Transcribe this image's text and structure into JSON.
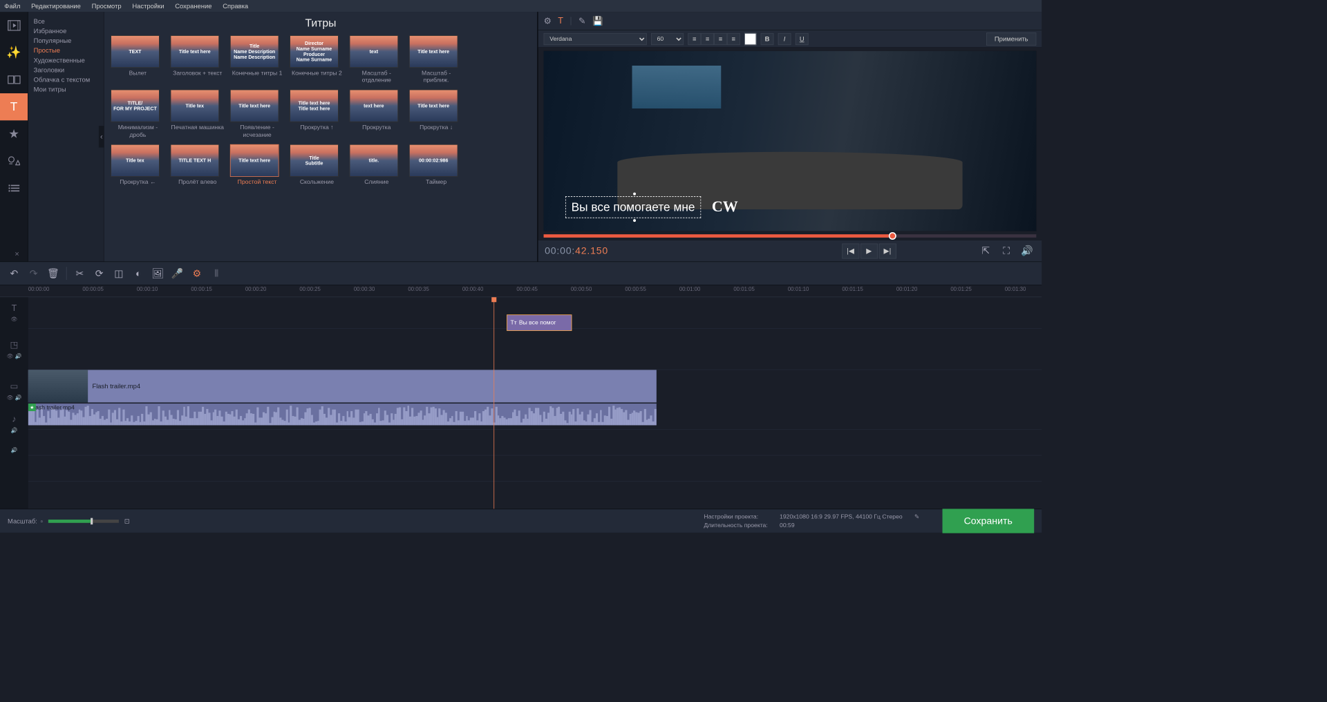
{
  "menu": [
    "Файл",
    "Редактирование",
    "Просмотр",
    "Настройки",
    "Сохранение",
    "Справка"
  ],
  "categories": {
    "items": [
      "Все",
      "Избранное",
      "Популярные",
      "Простые",
      "Художественные",
      "Заголовки",
      "Облачка с текстом",
      "Мои титры"
    ],
    "active": "Простые"
  },
  "gallery": {
    "title": "Титры",
    "items": [
      {
        "label": "Вылет",
        "preview": "TEXT"
      },
      {
        "label": "Заголовок + текст",
        "preview": "Title text here"
      },
      {
        "label": "Конечные титры 1",
        "preview": "Title\nName Description\nName Description"
      },
      {
        "label": "Конечные титры 2",
        "preview": "Director\nName Surname\nProducer\nName Surname"
      },
      {
        "label": "Масштаб - отдаление",
        "preview": "text"
      },
      {
        "label": "Масштаб - приближ.",
        "preview": "Title text here"
      },
      {
        "label": "Минимализм - дробь",
        "preview": "TITLE/\nFOR MY PROJECT"
      },
      {
        "label": "Печатная машинка",
        "preview": "Title tex"
      },
      {
        "label": "Появление - исчезание",
        "preview": "Title text here"
      },
      {
        "label": "Прокрутка ↑",
        "preview": "Title text here\nTitle text here"
      },
      {
        "label": "Прокрутка",
        "preview": "text here"
      },
      {
        "label": "Прокрутка ↓",
        "preview": "Title text here"
      },
      {
        "label": "Прокрутка ←",
        "preview": "Title tex"
      },
      {
        "label": "Пролёт влево",
        "preview": "TITLE TEXT H"
      },
      {
        "label": "Простой текст",
        "preview": "Title text here",
        "selected": true
      },
      {
        "label": "Скольжение",
        "preview": "Title\nSubtitle"
      },
      {
        "label": "Слияние",
        "preview": "title."
      },
      {
        "label": "Таймер",
        "preview": "00:00:02:986"
      }
    ]
  },
  "text_tools": {
    "font": "Verdana",
    "size": "60",
    "apply": "Применить"
  },
  "preview": {
    "title_text": "Вы все помогаете мне",
    "network": "CW"
  },
  "transport": {
    "time_prefix": "00:00:",
    "time_accent": "42.150"
  },
  "timeline": {
    "marks": [
      "00:00:00",
      "00:00:05",
      "00:00:10",
      "00:00:15",
      "00:00:20",
      "00:00:25",
      "00:00:30",
      "00:00:35",
      "00:00:40",
      "00:00:45",
      "00:00:50",
      "00:00:55",
      "00:01:00",
      "00:01:05",
      "00:01:10",
      "00:01:15",
      "00:01:20",
      "00:01:25",
      "00:01:30"
    ],
    "title_clip": "Вы все помог",
    "video_clip": "Flash trailer.mp4",
    "audio_clip": "Flash trailer.mp4"
  },
  "footer": {
    "zoom_label": "Масштаб:",
    "settings_label": "Настройки проекта:",
    "settings_value": "1920x1080 16:9 29.97 FPS, 44100 Гц Стерео",
    "duration_label": "Длительность проекта:",
    "duration_value": "00:59",
    "save": "Сохранить"
  }
}
